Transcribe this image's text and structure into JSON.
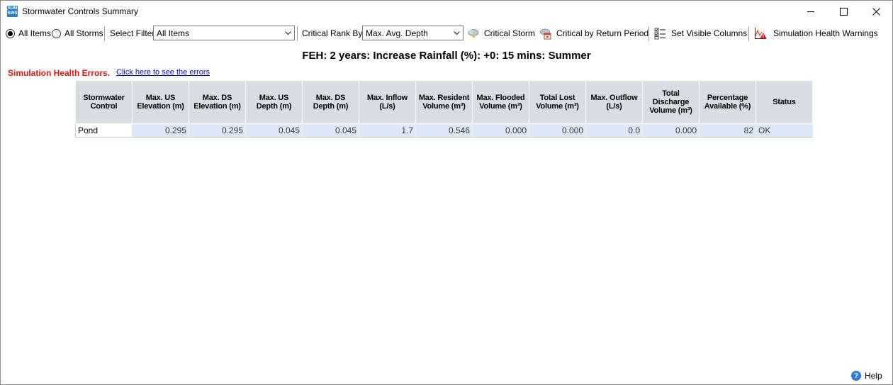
{
  "window": {
    "title": "Stormwater Controls Summary",
    "app_icon_text": [
      "SUM",
      "SWS"
    ]
  },
  "toolbar": {
    "all_items_label": "All Items",
    "all_storms_label": "All Storms",
    "selected_radio": "all_items",
    "select_filter_label": "Select Filter",
    "filter_value": "All Items",
    "critical_rank_label": "Critical Rank By:",
    "critical_rank_value": "Max. Avg. Depth",
    "critical_storm_label": "Critical Storm",
    "critical_return_label": "Critical by Return Period",
    "visible_columns_label": "Set Visible Columns",
    "health_warnings_label": "Simulation Health Warnings"
  },
  "scenario_title": "FEH: 2 years: Increase Rainfall (%): +0: 15 mins: Summer",
  "errors": {
    "label": "Simulation Health Errors.",
    "link": "Click here to see the errors"
  },
  "table": {
    "columns": [
      [
        "Stormwater",
        "Control"
      ],
      [
        "Max. US",
        "Elevation (m)"
      ],
      [
        "Max. DS",
        "Elevation (m)"
      ],
      [
        "Max. US",
        "Depth (m)"
      ],
      [
        "Max. DS",
        "Depth (m)"
      ],
      [
        "Max. Inflow",
        "(L/s)"
      ],
      [
        "Max. Resident",
        "Volume (m³)"
      ],
      [
        "Max. Flooded",
        "Volume (m³)"
      ],
      [
        "Total Lost",
        "Volume (m³)"
      ],
      [
        "Max. Outflow",
        "(L/s)"
      ],
      [
        "Total",
        "Discharge",
        "Volume (m³)"
      ],
      [
        "Percentage",
        "Available (%)"
      ],
      [
        "Status"
      ]
    ],
    "rows": [
      [
        "Pond",
        "0.295",
        "0.295",
        "0.045",
        "0.045",
        "1.7",
        "0.546",
        "0.000",
        "0.000",
        "0.0",
        "0.000",
        "82",
        "OK"
      ]
    ]
  },
  "footer": {
    "help_label": "Help",
    "help_icon_glyph": "?"
  },
  "colors": {
    "error_red": "#e81010",
    "link_blue": "#0000ee",
    "header_bg": "#d8dde3",
    "cell_bg": "#dce8f6"
  },
  "icons": {
    "minimize": "minimize-icon",
    "maximize": "maximize-icon",
    "close": "close-icon",
    "critical_storm": "storm-cloud-icon",
    "critical_return": "calendar-cloud-icon",
    "visible_columns": "checklist-icon",
    "health_warnings": "warning-chart-icon",
    "help": "help-icon"
  }
}
